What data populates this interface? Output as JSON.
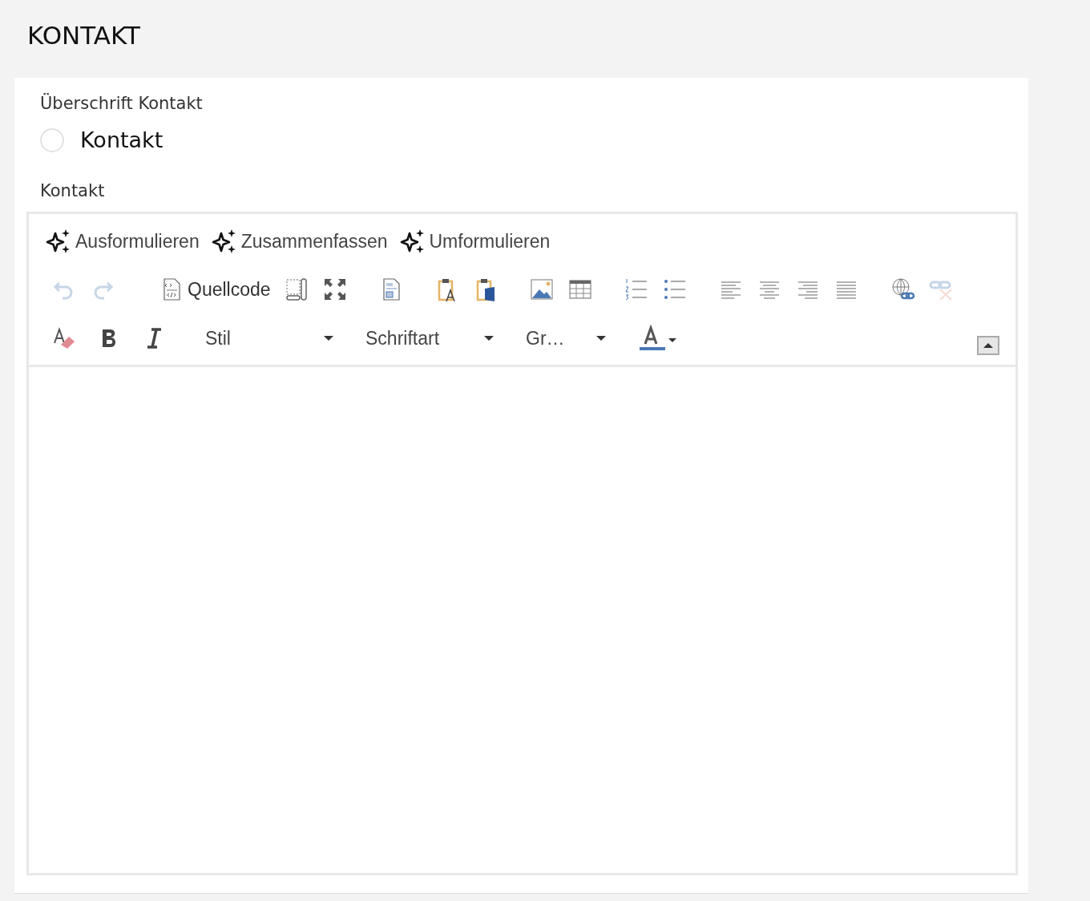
{
  "page_title": "KONTAKT",
  "heading_field": {
    "label": "Überschrift Kontakt",
    "options": [
      {
        "label": "Kontakt",
        "selected": false
      }
    ]
  },
  "editor": {
    "label": "Kontakt",
    "ai_actions": [
      "Ausformulieren",
      "Zusammenfassen",
      "Umformulieren"
    ],
    "toolbar": [
      {
        "kind": "undo",
        "disabled": true
      },
      {
        "kind": "redo",
        "disabled": true
      },
      {
        "kind": "source",
        "label": "Quellcode",
        "disabled": false
      },
      {
        "kind": "blocks",
        "disabled": false
      },
      {
        "kind": "maximize",
        "disabled": false
      },
      {
        "kind": "preview",
        "disabled": false
      },
      {
        "kind": "paste-text",
        "disabled": false
      },
      {
        "kind": "paste-word",
        "disabled": false
      },
      {
        "kind": "image",
        "disabled": false
      },
      {
        "kind": "table",
        "disabled": false
      },
      {
        "kind": "numbered-list",
        "disabled": false
      },
      {
        "kind": "bullet-list",
        "disabled": false
      },
      {
        "kind": "align-left",
        "disabled": false
      },
      {
        "kind": "align-center",
        "disabled": false
      },
      {
        "kind": "align-right",
        "disabled": false
      },
      {
        "kind": "justify",
        "disabled": false
      },
      {
        "kind": "link",
        "disabled": false
      },
      {
        "kind": "unlink",
        "disabled": true
      }
    ],
    "format_bar": [
      {
        "kind": "remove-format",
        "disabled": false
      },
      {
        "kind": "bold",
        "disabled": false
      },
      {
        "kind": "italic",
        "disabled": false
      },
      {
        "kind": "combo",
        "label": "Stil"
      },
      {
        "kind": "combo",
        "label": "Schriftart"
      },
      {
        "kind": "combo-small",
        "label": "Gr…"
      },
      {
        "kind": "text-color",
        "disabled": false
      }
    ]
  }
}
